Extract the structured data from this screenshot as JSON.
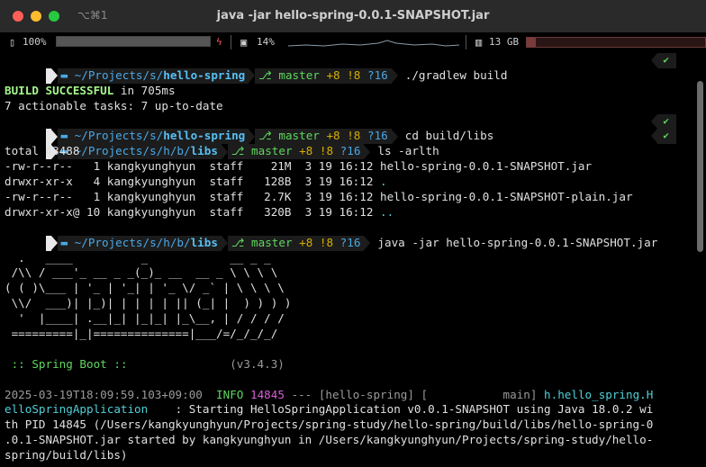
{
  "window": {
    "title": "java -jar hello-spring-0.0.1-SNAPSHOT.jar",
    "shortcut": "⌥⌘1"
  },
  "status": {
    "battery": "100%",
    "cpu": "14%",
    "memory": "13 GB",
    "battery_level": 1.0,
    "cpu_level": 0.14
  },
  "prompt": {
    "path_full_prefix": "~/Projects/s/",
    "path_full_dir": "hello-spring",
    "path_libs_prefix": "~/Projects/s/h/b/",
    "path_libs_dir": "libs",
    "branch": "master",
    "git_ahead": "+8",
    "git_modified": "!8",
    "git_untracked": "?16",
    "ok_mark": "✔"
  },
  "lines": {
    "cmd1": "./gradlew build",
    "build_status": "BUILD SUCCESSFUL",
    "build_time": " in 705ms",
    "tasks": "7 actionable tasks: 7 up-to-date",
    "cmd2": "cd build/libs",
    "cmd3": "ls -arlth",
    "total": "total 43488",
    "ls1_pre": "-rw-r--r--   1 kangkyunghyun  staff    21M  3 19 16:12 ",
    "ls1_name": "hello-spring-0.0.1-SNAPSHOT.jar",
    "ls2_pre": "drwxr-xr-x   4 kangkyunghyun  staff   128B  3 19 16:12 ",
    "ls2_name": ".",
    "ls3_pre": "-rw-r--r--   1 kangkyunghyun  staff   2.7K  3 19 16:12 ",
    "ls3_name": "hello-spring-0.0.1-SNAPSHOT-plain.jar",
    "ls4_pre": "drwxr-xr-x@ 10 kangkyunghyun  staff   320B  3 19 16:12 ",
    "ls4_name": "..",
    "cmd4": "java -jar hello-spring-0.0.1-SNAPSHOT.jar"
  },
  "banner": [
    "  .   ____          _            __ _ _",
    " /\\\\ / ___'_ __ _ _(_)_ __  __ _ \\ \\ \\ \\",
    "( ( )\\___ | '_ | '_| | '_ \\/ _` | \\ \\ \\ \\",
    " \\\\/  ___)| |_)| | | | | || (_| |  ) ) ) )",
    "  '  |____| .__|_| |_|_| |_\\__, | / / / /",
    " =========|_|==============|___/=/_/_/_/"
  ],
  "spring": {
    "label": " :: Spring Boot :: ",
    "version": "(v3.4.3)"
  },
  "log": {
    "timestamp": "2025-03-19T18:09:59.103+09:00  ",
    "level": "INFO",
    "pid": "14845",
    "sep": " --- [hello-spring] [           main] ",
    "logger1": "h.hello_spring.H",
    "logger2": "elloSpringApplication",
    "msg1": "    : Starting HelloSpringApplication v0.0.1-SNAPSHOT using Java 18.0.2 wi",
    "msg2": "th PID 14845 (/Users/kangkyunghyun/Projects/spring-study/hello-spring/build/libs/hello-spring-0",
    "msg3": ".0.1-SNAPSHOT.jar started by kangkyunghyun in /Users/kangkyunghyun/Projects/spring-study/hello-",
    "msg4": "spring/build/libs)"
  }
}
